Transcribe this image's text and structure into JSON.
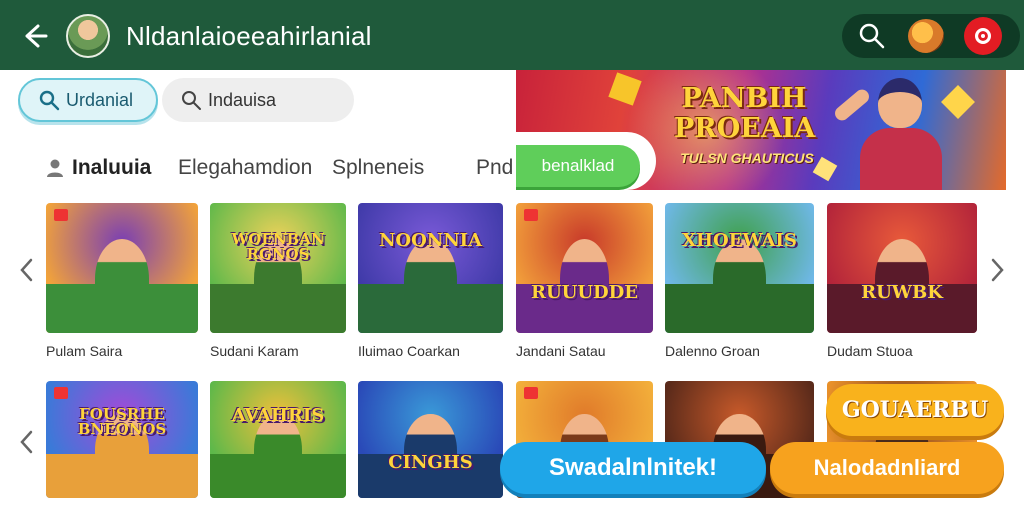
{
  "colors": {
    "topbar": "#1f5a3b",
    "actions_bg": "#0f3a25",
    "notif": "#e31c23",
    "chip_active_border": "#63c6d8",
    "cta_green": "#5fce5a",
    "cta_blue": "#1fa6e8",
    "cta_orange": "#f7a21e"
  },
  "header": {
    "back_icon": "arrow-left-icon",
    "title": "Nldanlaioeeahirlanial",
    "actions": [
      "search-icon",
      "mascot-avatar",
      "notification-icon"
    ]
  },
  "search_chips": [
    {
      "label": "Urdanial",
      "icon": "search-icon",
      "active": true
    },
    {
      "label": "Indauisa",
      "icon": "search-icon",
      "active": false
    }
  ],
  "tabs": [
    {
      "label": "Inaluuia",
      "icon": "user-icon",
      "active": true
    },
    {
      "label": "Elegahamdion",
      "active": false
    },
    {
      "label": "Splneneis",
      "active": false
    },
    {
      "label": "Pnd",
      "active": false
    }
  ],
  "banner": {
    "title": "PANBIH PROEAIA",
    "subtitle": "TULSN GHAUTICUS",
    "cta": "benalklad"
  },
  "games": [
    {
      "name": "Pulam Saira",
      "logo": ""
    },
    {
      "name": "Sudani Karam",
      "logo": "WOENBAN RGNOS"
    },
    {
      "name": "Iluimao Coarkan",
      "logo": "NOONNIA"
    },
    {
      "name": "Jandani Satau",
      "logo": "RUUUDDE"
    },
    {
      "name": "Dalenno Groan",
      "logo": "XHOEWAIS"
    },
    {
      "name": "Dudam Stuoa",
      "logo": "RUWBK"
    },
    {
      "name": "",
      "logo": "FOUSRHE BNEONOS"
    },
    {
      "name": "",
      "logo": "AVAHRIS"
    },
    {
      "name": "",
      "logo": "CINGHS"
    },
    {
      "name": "",
      "logo": ""
    },
    {
      "name": "",
      "logo": ""
    },
    {
      "name": "",
      "logo": ""
    }
  ],
  "ctas": {
    "primary": "Swadalnlnitek!",
    "secondary": "Nalodadnliard",
    "tertiary": "GOUAERBU"
  }
}
